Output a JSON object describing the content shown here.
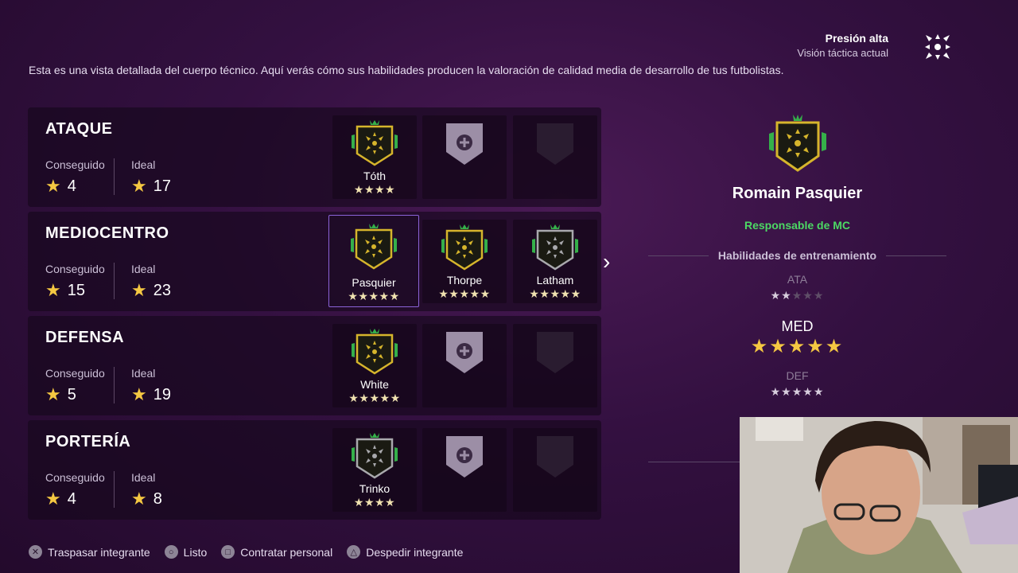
{
  "tactic": {
    "title": "Presión alta",
    "subtitle": "Visión táctica actual",
    "icon": "tactic-formation-icon"
  },
  "intro": "Esta es una vista detallada del cuerpo técnico. Aquí verás cómo sus habilidades producen la valoración de calidad media de desarrollo de tus futbolistas.",
  "labels": {
    "achieved": "Conseguido",
    "ideal": "Ideal"
  },
  "sections": [
    {
      "title": "ATAQUE",
      "achieved": "4",
      "ideal": "17",
      "slots": [
        {
          "type": "coach",
          "name": "Tóth",
          "stars": "★★★★",
          "badge": "gold"
        },
        {
          "type": "add"
        },
        {
          "type": "locked"
        }
      ]
    },
    {
      "title": "MEDIOCENTRO",
      "achieved": "15",
      "ideal": "23",
      "slots": [
        {
          "type": "coach",
          "name": "Pasquier",
          "stars": "★★★★★",
          "badge": "gold",
          "selected": true
        },
        {
          "type": "coach",
          "name": "Thorpe",
          "stars": "★★★★★",
          "badge": "gold"
        },
        {
          "type": "coach",
          "name": "Latham",
          "stars": "★★★★★",
          "badge": "silver"
        }
      ]
    },
    {
      "title": "DEFENSA",
      "achieved": "5",
      "ideal": "19",
      "slots": [
        {
          "type": "coach",
          "name": "White",
          "stars": "★★★★★",
          "badge": "gold"
        },
        {
          "type": "add"
        },
        {
          "type": "locked"
        }
      ]
    },
    {
      "title": "PORTERÍA",
      "achieved": "4",
      "ideal": "8",
      "slots": [
        {
          "type": "coach",
          "name": "Trinko",
          "stars": "★★★★",
          "badge": "silver"
        },
        {
          "type": "add"
        },
        {
          "type": "locked"
        }
      ]
    }
  ],
  "detail": {
    "name": "Romain Pasquier",
    "role": "Responsable de MC",
    "skills_heading": "Habilidades de entrenamiento",
    "skills": [
      {
        "label": "ATA",
        "on": 2,
        "total": 5,
        "active": false
      },
      {
        "label": "MED",
        "on": 5,
        "total": 5,
        "active": true
      },
      {
        "label": "DEF",
        "on": 5,
        "total": 5,
        "active": false
      }
    ]
  },
  "footer": [
    {
      "glyph": "✕",
      "label": "Traspasar integrante",
      "icon": "cross-button-icon"
    },
    {
      "glyph": "○",
      "label": "Listo",
      "icon": "circle-button-icon"
    },
    {
      "glyph": "□",
      "label": "Contratar personal",
      "icon": "square-button-icon"
    },
    {
      "glyph": "△",
      "label": "Despedir integrante",
      "icon": "triangle-button-icon"
    }
  ],
  "colors": {
    "accent_green": "#4cd964",
    "gold": "#f5c842",
    "selected_border": "#8b63d8"
  }
}
